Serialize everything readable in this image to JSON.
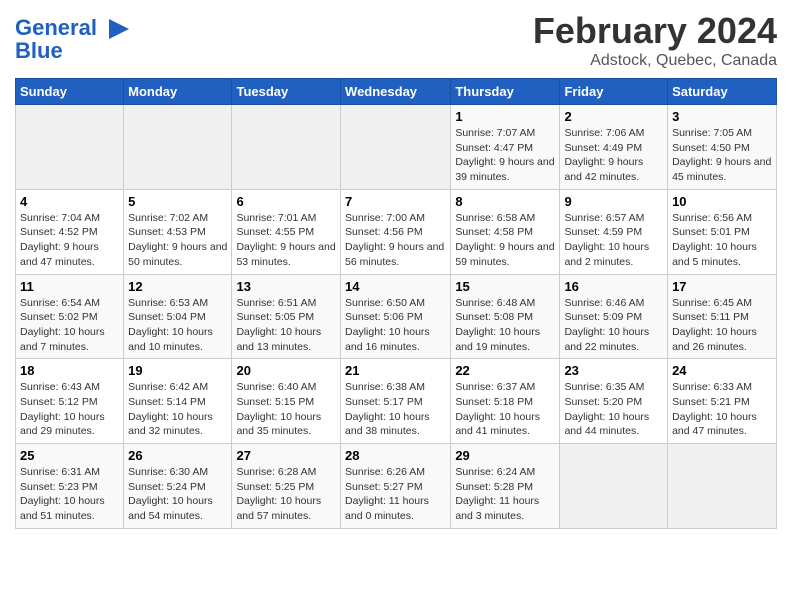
{
  "header": {
    "logo_line1": "General",
    "logo_line2": "Blue",
    "title": "February 2024",
    "subtitle": "Adstock, Quebec, Canada"
  },
  "weekdays": [
    "Sunday",
    "Monday",
    "Tuesday",
    "Wednesday",
    "Thursday",
    "Friday",
    "Saturday"
  ],
  "weeks": [
    [
      {
        "day": "",
        "empty": true
      },
      {
        "day": "",
        "empty": true
      },
      {
        "day": "",
        "empty": true
      },
      {
        "day": "",
        "empty": true
      },
      {
        "day": "1",
        "sunrise": "Sunrise: 7:07 AM",
        "sunset": "Sunset: 4:47 PM",
        "daylight": "Daylight: 9 hours and 39 minutes."
      },
      {
        "day": "2",
        "sunrise": "Sunrise: 7:06 AM",
        "sunset": "Sunset: 4:49 PM",
        "daylight": "Daylight: 9 hours and 42 minutes."
      },
      {
        "day": "3",
        "sunrise": "Sunrise: 7:05 AM",
        "sunset": "Sunset: 4:50 PM",
        "daylight": "Daylight: 9 hours and 45 minutes."
      }
    ],
    [
      {
        "day": "4",
        "sunrise": "Sunrise: 7:04 AM",
        "sunset": "Sunset: 4:52 PM",
        "daylight": "Daylight: 9 hours and 47 minutes."
      },
      {
        "day": "5",
        "sunrise": "Sunrise: 7:02 AM",
        "sunset": "Sunset: 4:53 PM",
        "daylight": "Daylight: 9 hours and 50 minutes."
      },
      {
        "day": "6",
        "sunrise": "Sunrise: 7:01 AM",
        "sunset": "Sunset: 4:55 PM",
        "daylight": "Daylight: 9 hours and 53 minutes."
      },
      {
        "day": "7",
        "sunrise": "Sunrise: 7:00 AM",
        "sunset": "Sunset: 4:56 PM",
        "daylight": "Daylight: 9 hours and 56 minutes."
      },
      {
        "day": "8",
        "sunrise": "Sunrise: 6:58 AM",
        "sunset": "Sunset: 4:58 PM",
        "daylight": "Daylight: 9 hours and 59 minutes."
      },
      {
        "day": "9",
        "sunrise": "Sunrise: 6:57 AM",
        "sunset": "Sunset: 4:59 PM",
        "daylight": "Daylight: 10 hours and 2 minutes."
      },
      {
        "day": "10",
        "sunrise": "Sunrise: 6:56 AM",
        "sunset": "Sunset: 5:01 PM",
        "daylight": "Daylight: 10 hours and 5 minutes."
      }
    ],
    [
      {
        "day": "11",
        "sunrise": "Sunrise: 6:54 AM",
        "sunset": "Sunset: 5:02 PM",
        "daylight": "Daylight: 10 hours and 7 minutes."
      },
      {
        "day": "12",
        "sunrise": "Sunrise: 6:53 AM",
        "sunset": "Sunset: 5:04 PM",
        "daylight": "Daylight: 10 hours and 10 minutes."
      },
      {
        "day": "13",
        "sunrise": "Sunrise: 6:51 AM",
        "sunset": "Sunset: 5:05 PM",
        "daylight": "Daylight: 10 hours and 13 minutes."
      },
      {
        "day": "14",
        "sunrise": "Sunrise: 6:50 AM",
        "sunset": "Sunset: 5:06 PM",
        "daylight": "Daylight: 10 hours and 16 minutes."
      },
      {
        "day": "15",
        "sunrise": "Sunrise: 6:48 AM",
        "sunset": "Sunset: 5:08 PM",
        "daylight": "Daylight: 10 hours and 19 minutes."
      },
      {
        "day": "16",
        "sunrise": "Sunrise: 6:46 AM",
        "sunset": "Sunset: 5:09 PM",
        "daylight": "Daylight: 10 hours and 22 minutes."
      },
      {
        "day": "17",
        "sunrise": "Sunrise: 6:45 AM",
        "sunset": "Sunset: 5:11 PM",
        "daylight": "Daylight: 10 hours and 26 minutes."
      }
    ],
    [
      {
        "day": "18",
        "sunrise": "Sunrise: 6:43 AM",
        "sunset": "Sunset: 5:12 PM",
        "daylight": "Daylight: 10 hours and 29 minutes."
      },
      {
        "day": "19",
        "sunrise": "Sunrise: 6:42 AM",
        "sunset": "Sunset: 5:14 PM",
        "daylight": "Daylight: 10 hours and 32 minutes."
      },
      {
        "day": "20",
        "sunrise": "Sunrise: 6:40 AM",
        "sunset": "Sunset: 5:15 PM",
        "daylight": "Daylight: 10 hours and 35 minutes."
      },
      {
        "day": "21",
        "sunrise": "Sunrise: 6:38 AM",
        "sunset": "Sunset: 5:17 PM",
        "daylight": "Daylight: 10 hours and 38 minutes."
      },
      {
        "day": "22",
        "sunrise": "Sunrise: 6:37 AM",
        "sunset": "Sunset: 5:18 PM",
        "daylight": "Daylight: 10 hours and 41 minutes."
      },
      {
        "day": "23",
        "sunrise": "Sunrise: 6:35 AM",
        "sunset": "Sunset: 5:20 PM",
        "daylight": "Daylight: 10 hours and 44 minutes."
      },
      {
        "day": "24",
        "sunrise": "Sunrise: 6:33 AM",
        "sunset": "Sunset: 5:21 PM",
        "daylight": "Daylight: 10 hours and 47 minutes."
      }
    ],
    [
      {
        "day": "25",
        "sunrise": "Sunrise: 6:31 AM",
        "sunset": "Sunset: 5:23 PM",
        "daylight": "Daylight: 10 hours and 51 minutes."
      },
      {
        "day": "26",
        "sunrise": "Sunrise: 6:30 AM",
        "sunset": "Sunset: 5:24 PM",
        "daylight": "Daylight: 10 hours and 54 minutes."
      },
      {
        "day": "27",
        "sunrise": "Sunrise: 6:28 AM",
        "sunset": "Sunset: 5:25 PM",
        "daylight": "Daylight: 10 hours and 57 minutes."
      },
      {
        "day": "28",
        "sunrise": "Sunrise: 6:26 AM",
        "sunset": "Sunset: 5:27 PM",
        "daylight": "Daylight: 11 hours and 0 minutes."
      },
      {
        "day": "29",
        "sunrise": "Sunrise: 6:24 AM",
        "sunset": "Sunset: 5:28 PM",
        "daylight": "Daylight: 11 hours and 3 minutes."
      },
      {
        "day": "",
        "empty": true
      },
      {
        "day": "",
        "empty": true
      }
    ]
  ]
}
